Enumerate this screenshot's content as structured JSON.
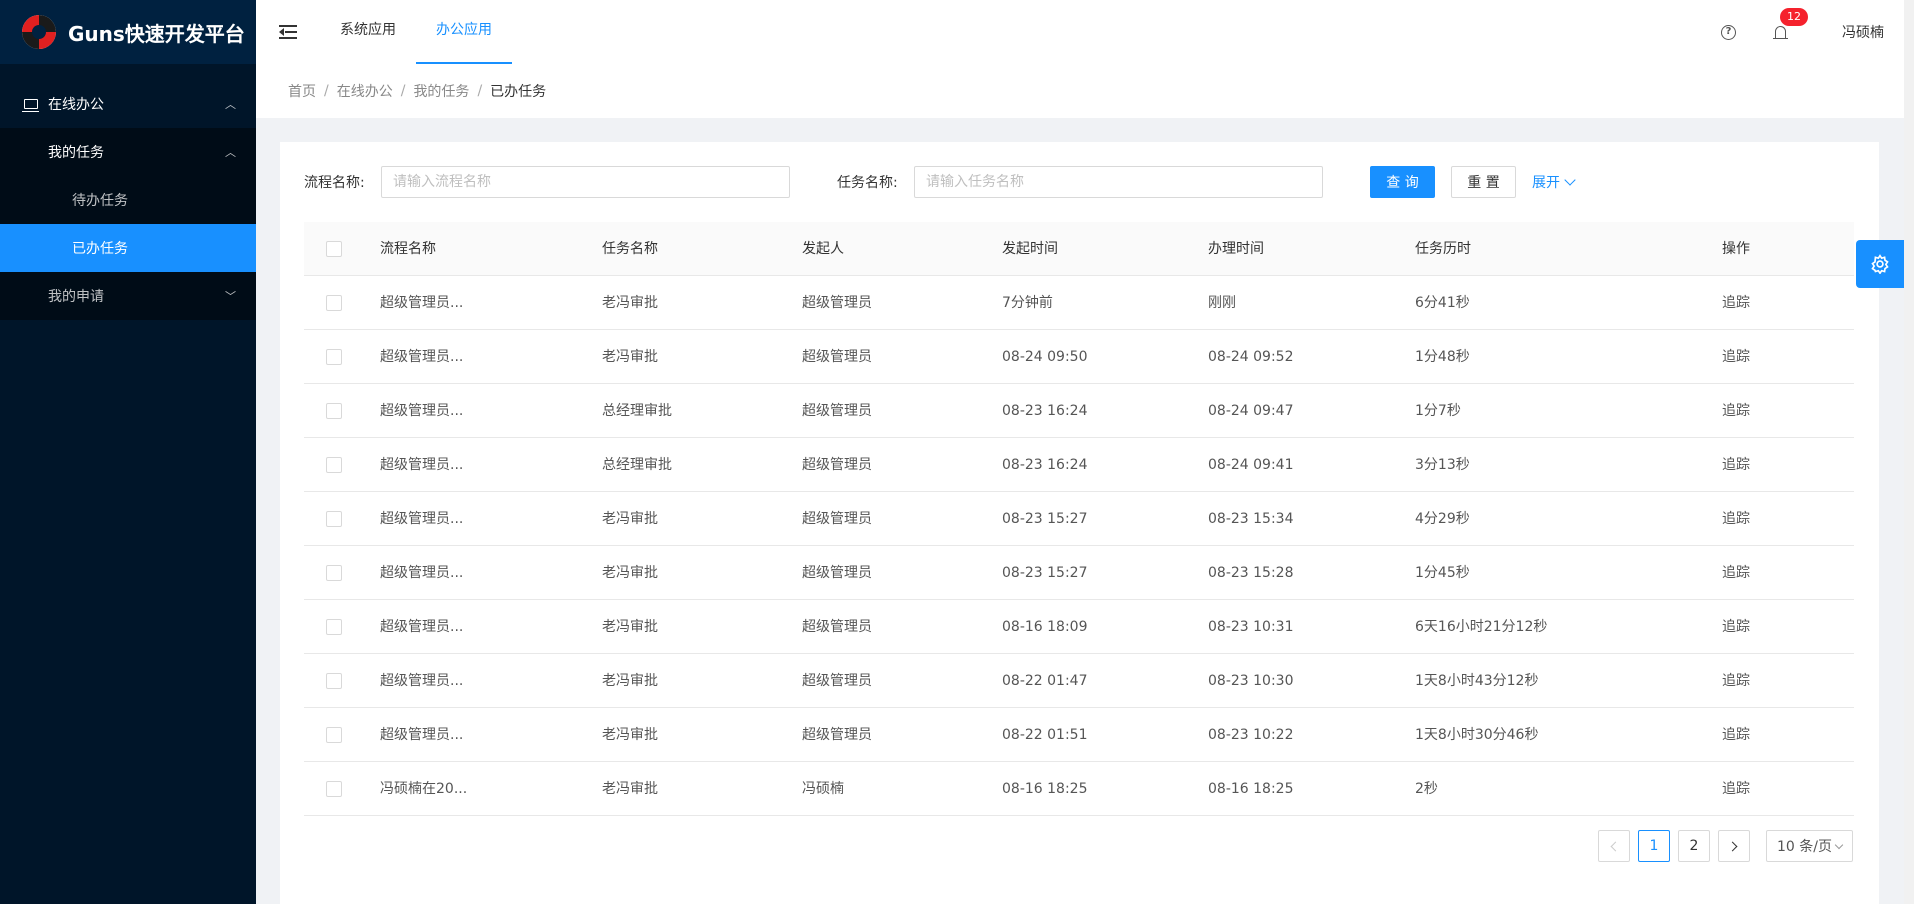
{
  "app": {
    "title": "Guns快速开发平台"
  },
  "sidebar": {
    "menu": [
      {
        "label": "在线办公"
      },
      {
        "label": "我的任务"
      },
      {
        "label": "待办任务"
      },
      {
        "label": "已办任务"
      },
      {
        "label": "我的申请"
      }
    ]
  },
  "header": {
    "tabs": [
      {
        "label": "系统应用"
      },
      {
        "label": "办公应用"
      }
    ],
    "notification_count": "12",
    "username": "冯硕楠"
  },
  "breadcrumb": [
    "首页",
    "在线办公",
    "我的任务",
    "已办任务"
  ],
  "filters": {
    "process_label": "流程名称:",
    "process_placeholder": "请输入流程名称",
    "task_label": "任务名称:",
    "task_placeholder": "请输入任务名称",
    "search_btn": "查 询",
    "reset_btn": "重 置",
    "expand": "展开"
  },
  "table": {
    "headers": [
      "流程名称",
      "任务名称",
      "发起人",
      "发起时间",
      "办理时间",
      "任务历时",
      "操作"
    ],
    "rows": [
      {
        "process": "超级管理员...",
        "task": "老冯审批",
        "initiator": "超级管理员",
        "start": "7分钟前",
        "handled": "刚刚",
        "duration": "6分41秒",
        "action": "追踪"
      },
      {
        "process": "超级管理员...",
        "task": "老冯审批",
        "initiator": "超级管理员",
        "start": "08-24 09:50",
        "handled": "08-24 09:52",
        "duration": "1分48秒",
        "action": "追踪"
      },
      {
        "process": "超级管理员...",
        "task": "总经理审批",
        "initiator": "超级管理员",
        "start": "08-23 16:24",
        "handled": "08-24 09:47",
        "duration": "1分7秒",
        "action": "追踪"
      },
      {
        "process": "超级管理员...",
        "task": "总经理审批",
        "initiator": "超级管理员",
        "start": "08-23 16:24",
        "handled": "08-24 09:41",
        "duration": "3分13秒",
        "action": "追踪"
      },
      {
        "process": "超级管理员...",
        "task": "老冯审批",
        "initiator": "超级管理员",
        "start": "08-23 15:27",
        "handled": "08-23 15:34",
        "duration": "4分29秒",
        "action": "追踪"
      },
      {
        "process": "超级管理员...",
        "task": "老冯审批",
        "initiator": "超级管理员",
        "start": "08-23 15:27",
        "handled": "08-23 15:28",
        "duration": "1分45秒",
        "action": "追踪"
      },
      {
        "process": "超级管理员...",
        "task": "老冯审批",
        "initiator": "超级管理员",
        "start": "08-16 18:09",
        "handled": "08-23 10:31",
        "duration": "6天16小时21分12秒",
        "action": "追踪"
      },
      {
        "process": "超级管理员...",
        "task": "老冯审批",
        "initiator": "超级管理员",
        "start": "08-22 01:47",
        "handled": "08-23 10:30",
        "duration": "1天8小时43分12秒",
        "action": "追踪"
      },
      {
        "process": "超级管理员...",
        "task": "老冯审批",
        "initiator": "超级管理员",
        "start": "08-22 01:51",
        "handled": "08-23 10:22",
        "duration": "1天8小时30分46秒",
        "action": "追踪"
      },
      {
        "process": "冯硕楠在20...",
        "task": "老冯审批",
        "initiator": "冯硕楠",
        "start": "08-16 18:25",
        "handled": "08-16 18:25",
        "duration": "2秒",
        "action": "追踪"
      }
    ]
  },
  "pagination": {
    "pages": [
      "1",
      "2"
    ],
    "page_size": "10 条/页"
  },
  "colors": {
    "primary": "#1890ff",
    "sidebar": "#001529",
    "badge": "#f5222d"
  }
}
